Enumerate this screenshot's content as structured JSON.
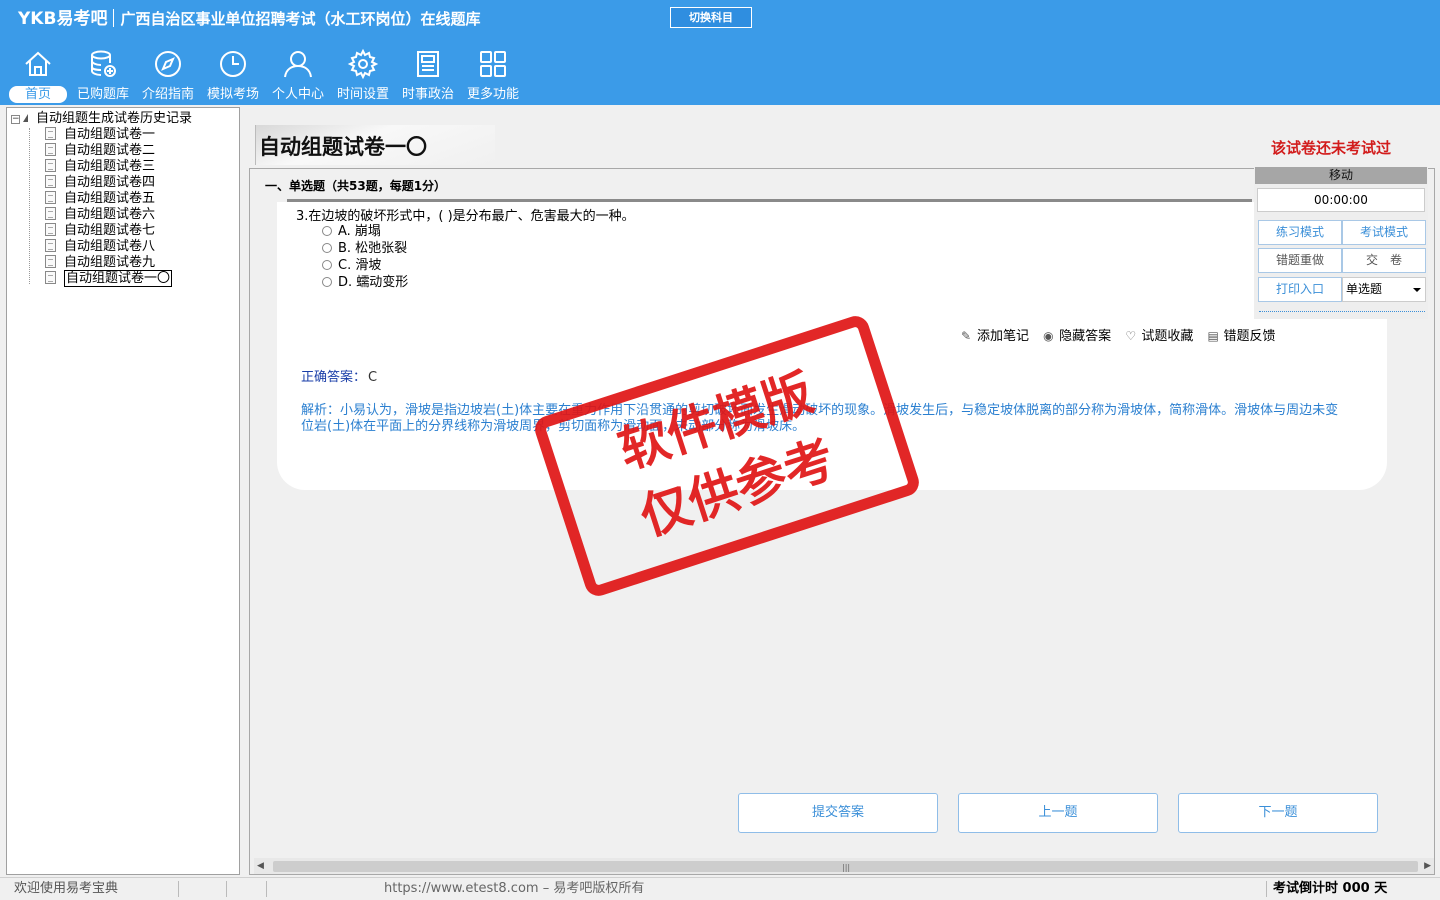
{
  "header": {
    "logo": "YKB易考吧",
    "title": "广西自治区事业单位招聘考试（水工环岗位）在线题库",
    "switch_subject": "切换科目",
    "nav": [
      {
        "label": "首页",
        "icon": "home-icon"
      },
      {
        "label": "已购题库",
        "icon": "database-icon"
      },
      {
        "label": "介绍指南",
        "icon": "compass-icon"
      },
      {
        "label": "模拟考场",
        "icon": "clock-icon"
      },
      {
        "label": "个人中心",
        "icon": "user-icon"
      },
      {
        "label": "时间设置",
        "icon": "gear-icon"
      },
      {
        "label": "时事政治",
        "icon": "newspaper-icon"
      },
      {
        "label": "更多功能",
        "icon": "grid-icon"
      }
    ],
    "active_nav": "首页"
  },
  "tree": {
    "root": "自动组题生成试卷历史记录",
    "items": [
      "自动组题试卷一",
      "自动组题试卷二",
      "自动组题试卷三",
      "自动组题试卷四",
      "自动组题试卷五",
      "自动组题试卷六",
      "自动组题试卷七",
      "自动组题试卷八",
      "自动组题试卷九",
      "自动组题试卷一〇"
    ],
    "selected": "自动组题试卷一〇"
  },
  "paper": {
    "title": "自动组题试卷一〇",
    "status": "该试卷还未考试过",
    "section": "一、单选题（共53题，每题1分）"
  },
  "question": {
    "text": "3.在边坡的破坏形式中，( )是分布最广、危害最大的一种。",
    "options": [
      "A. 崩塌",
      "B. 松弛张裂",
      "C. 滑坡",
      "D. 蠕动变形"
    ],
    "actions": {
      "add_note": "添加笔记",
      "hide_answer": "隐藏答案",
      "favorite": "试题收藏",
      "feedback": "错题反馈"
    },
    "answer_label": "正确答案：",
    "answer_value": "C",
    "analysis": "解析：小易认为，滑坡是指边坡岩(土)体主要在重力作用下沿贯通的剪切破坏面发生滑动破坏的现象。滑坡发生后，与稳定坡体脱离的部分称为滑坡体，简称滑体。滑坡体与周边未变位岩(土)体在平面上的分界线称为滑坡周界，剪切面称为滑动面，未动部分称为滑坡床。"
  },
  "panel": {
    "header": "移动",
    "timer": "00:00:00",
    "practice_mode": "练习模式",
    "exam_mode": "考试模式",
    "redo_wrong": "错题重做",
    "submit_paper": "交　卷",
    "print_entry": "打印入口",
    "question_type": "单选题"
  },
  "buttons": {
    "submit_answer": "提交答案",
    "prev": "上一题",
    "next": "下一题"
  },
  "stamp": {
    "line1": "软件模版",
    "line2": "仅供参考"
  },
  "status": {
    "welcome": "欢迎使用易考宝典",
    "copyright": "https://www.etest8.com – 易考吧版权所有",
    "countdown": "考试倒计时 000 天"
  },
  "colors": {
    "header_bg": "#3b9be8",
    "accent": "#3b8fd8",
    "warning": "#d21c1c",
    "stamp": "#e01515",
    "analysis": "#2a7fd0"
  }
}
